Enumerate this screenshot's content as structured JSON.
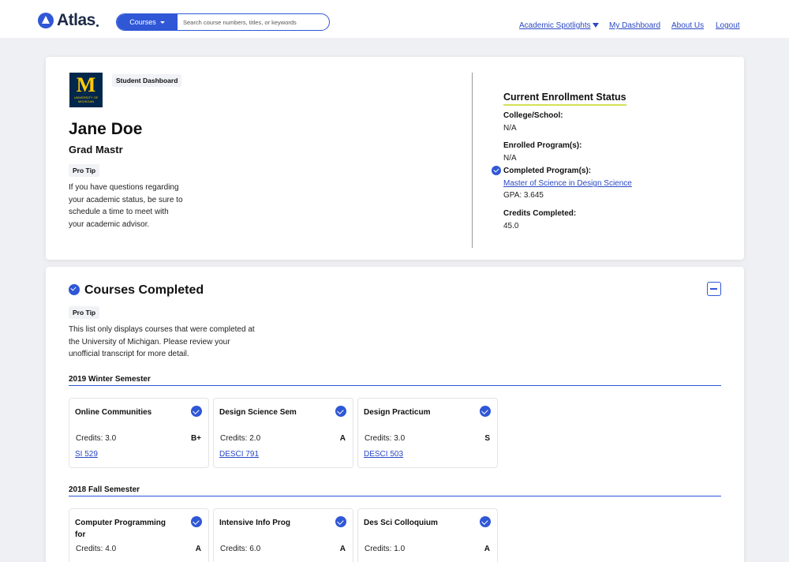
{
  "header": {
    "logo_text": "Atlas",
    "search_category": "Courses",
    "search_placeholder": "Search course numbers, titles, or keywords",
    "nav": [
      "Academic Spotlights",
      "My Dashboard",
      "About Us",
      "Logout"
    ]
  },
  "profile": {
    "badge": "Student Dashboard",
    "university_logo_text": "M",
    "university_logo_sub": "UNIVERSITY OF MICHIGAN",
    "name": "Jane Doe",
    "program": "Grad Mastr",
    "tip_label": "Pro Tip",
    "tip_lines": [
      "If you have questions regarding",
      "your academic status, be sure to",
      "schedule a time to meet with",
      "your academic advisor."
    ]
  },
  "enrollment": {
    "heading": "Current Enrollment Status",
    "college_label": "College/School:",
    "college_value": "N/A",
    "enrolled_label": "Enrolled Program(s):",
    "enrolled_value": "N/A",
    "completed_label": "Completed Program(s):",
    "completed_value": "Master of Science in Design Science",
    "gpa": "GPA: 3.645",
    "credits_label": "Credits Completed:",
    "credits_value": "45.0"
  },
  "courses_section": {
    "heading": "Courses Completed",
    "tip_label": "Pro Tip",
    "tip_lines": [
      "This list only displays courses that were completed at",
      "the University of Michigan. Please review your",
      "unofficial transcript for more detail."
    ],
    "semesters": [
      {
        "title": "2019 Winter Semester",
        "courses": [
          {
            "title": "Online Communities",
            "credits": "Credits: 3.0",
            "grade": "B+",
            "code": "SI 529"
          },
          {
            "title": "Design Science Sem",
            "credits": "Credits: 2.0",
            "grade": "A",
            "code": "DESCI 791"
          },
          {
            "title": "Design Practicum",
            "credits": "Credits: 3.0",
            "grade": "S",
            "code": "DESCI 503"
          }
        ]
      },
      {
        "title": "2018 Fall Semester",
        "courses": [
          {
            "title": "Computer Programming for",
            "credits": "Credits: 4.0",
            "grade": "A"
          },
          {
            "title": "Intensive Info Prog",
            "credits": "Credits: 6.0",
            "grade": "A"
          },
          {
            "title": "Des Sci Colloquium",
            "credits": "Credits: 1.0",
            "grade": "A"
          }
        ]
      }
    ]
  },
  "colors": {
    "accent": "#2f57d6",
    "underline": "#d4e157",
    "um_blue": "#00274c",
    "um_maize": "#ffcb05"
  }
}
